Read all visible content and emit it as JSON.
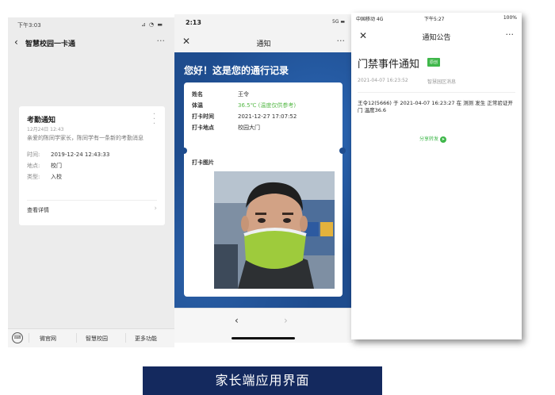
{
  "phone_left": {
    "status_time": "下午3:03",
    "status_icons": "⊿ ◔ ▬",
    "nav_title": "智慧校园一卡通",
    "card": {
      "title": "考勤通知",
      "date": "12月24日 12:43",
      "message": "亲爱的陈同学家长，陈同学有一条新的考勤消息",
      "rows": [
        {
          "label": "时间:",
          "value": "2019-12-24 12:43:33"
        },
        {
          "label": "地点:",
          "value": "校门"
        },
        {
          "label": "类型:",
          "value": "入校"
        }
      ],
      "detail_label": "查看详情"
    },
    "bottom_menu": [
      "微官网",
      "智慧校园",
      "更多功能"
    ]
  },
  "phone_middle": {
    "status_time": "2:13",
    "status_icons": "5G ▬",
    "nav_title": "通知",
    "headline": "您好！这是您的通行记录",
    "rows": [
      {
        "label": "姓名",
        "value": "王令"
      },
      {
        "label": "体温",
        "value": "36.5℃ (温度仅供参考)"
      },
      {
        "label": "打卡时间",
        "value": "2021-12-27 17:07:52"
      },
      {
        "label": "打卡地点",
        "value": "校园大门"
      }
    ],
    "photo_label": "打卡图片",
    "temp_color": "#56b948"
  },
  "phone_right": {
    "status_carrier": "中国移动 4G",
    "status_time": "下午5:27",
    "status_battery": "100%",
    "nav_title": "通知公告",
    "heading": "门禁事件通知",
    "badge": "原创",
    "meta_time": "2021-04-07 16:23:52",
    "meta_source": "智慧园区消息",
    "body": "王令12(5666) 于 2021-04-07 16:23:27 在 测测 发生 正常验证开门 温度36.6",
    "share_label": "分享转发",
    "accent": "#3fb74a"
  },
  "caption": "家长端应用界面"
}
